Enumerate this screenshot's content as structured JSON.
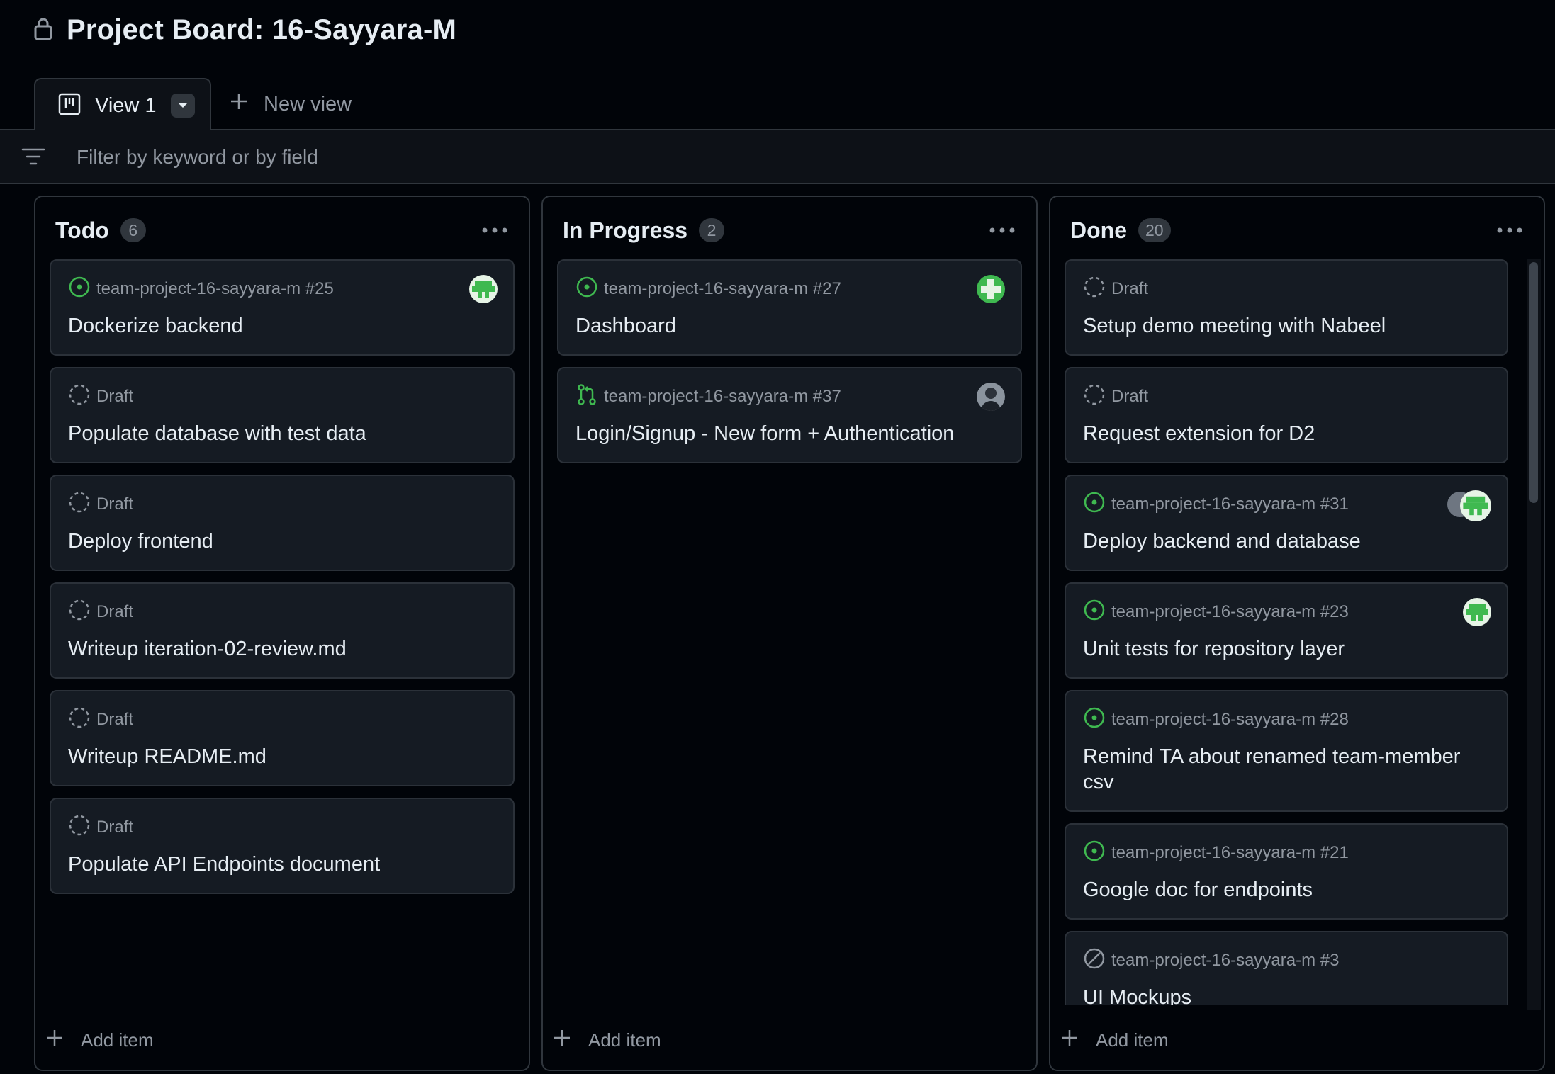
{
  "page": {
    "title": "Project Board: 16-Sayyara-M"
  },
  "tabs": {
    "active_label": "View 1",
    "new_view_label": "New view"
  },
  "filter": {
    "placeholder": "Filter by keyword or by field"
  },
  "colors": {
    "background": "#010409",
    "card": "#151b23",
    "border": "#30363d",
    "open_issue_green": "#3fb950",
    "muted_text": "#9198a1"
  },
  "columns": [
    {
      "title": "Todo",
      "count": "6",
      "cards": [
        {
          "status_icon": "issue-open-icon",
          "meta": "team-project-16-sayyara-m #25",
          "title": "Dockerize backend",
          "avatar": "identicon-green"
        },
        {
          "status_icon": "draft-icon",
          "meta": "Draft",
          "title": "Populate database with test data"
        },
        {
          "status_icon": "draft-icon",
          "meta": "Draft",
          "title": "Deploy frontend"
        },
        {
          "status_icon": "draft-icon",
          "meta": "Draft",
          "title": "Writeup iteration-02-review.md"
        },
        {
          "status_icon": "draft-icon",
          "meta": "Draft",
          "title": "Writeup README.md"
        },
        {
          "status_icon": "draft-icon",
          "meta": "Draft",
          "title": "Populate API Endpoints document"
        }
      ],
      "add_item_label": "Add item"
    },
    {
      "title": "In Progress",
      "count": "2",
      "cards": [
        {
          "status_icon": "issue-open-icon",
          "meta": "team-project-16-sayyara-m #27",
          "title": "Dashboard",
          "avatar": "identicon-cross"
        },
        {
          "status_icon": "pull-request-icon",
          "meta": "team-project-16-sayyara-m #37",
          "title": "Login/Signup - New form + Authentication",
          "avatar": "photo"
        }
      ],
      "add_item_label": "Add item"
    },
    {
      "title": "Done",
      "count": "20",
      "cards": [
        {
          "status_icon": "draft-icon",
          "meta": "Draft",
          "title": "Setup demo meeting with Nabeel"
        },
        {
          "status_icon": "draft-icon",
          "meta": "Draft",
          "title": "Request extension for D2"
        },
        {
          "status_icon": "issue-open-icon",
          "meta": "team-project-16-sayyara-m #31",
          "title": "Deploy backend and database",
          "avatar": "pair"
        },
        {
          "status_icon": "issue-open-icon",
          "meta": "team-project-16-sayyara-m #23",
          "title": "Unit tests for repository layer",
          "avatar": "identicon-green"
        },
        {
          "status_icon": "issue-open-icon",
          "meta": "team-project-16-sayyara-m #28",
          "title": "Remind TA about renamed team-member csv"
        },
        {
          "status_icon": "issue-open-icon",
          "meta": "team-project-16-sayyara-m #21",
          "title": "Google doc for endpoints"
        },
        {
          "status_icon": "issue-not-planned-icon",
          "meta": "team-project-16-sayyara-m #3",
          "title": "UI Mockups"
        }
      ],
      "add_item_label": "Add item"
    }
  ]
}
